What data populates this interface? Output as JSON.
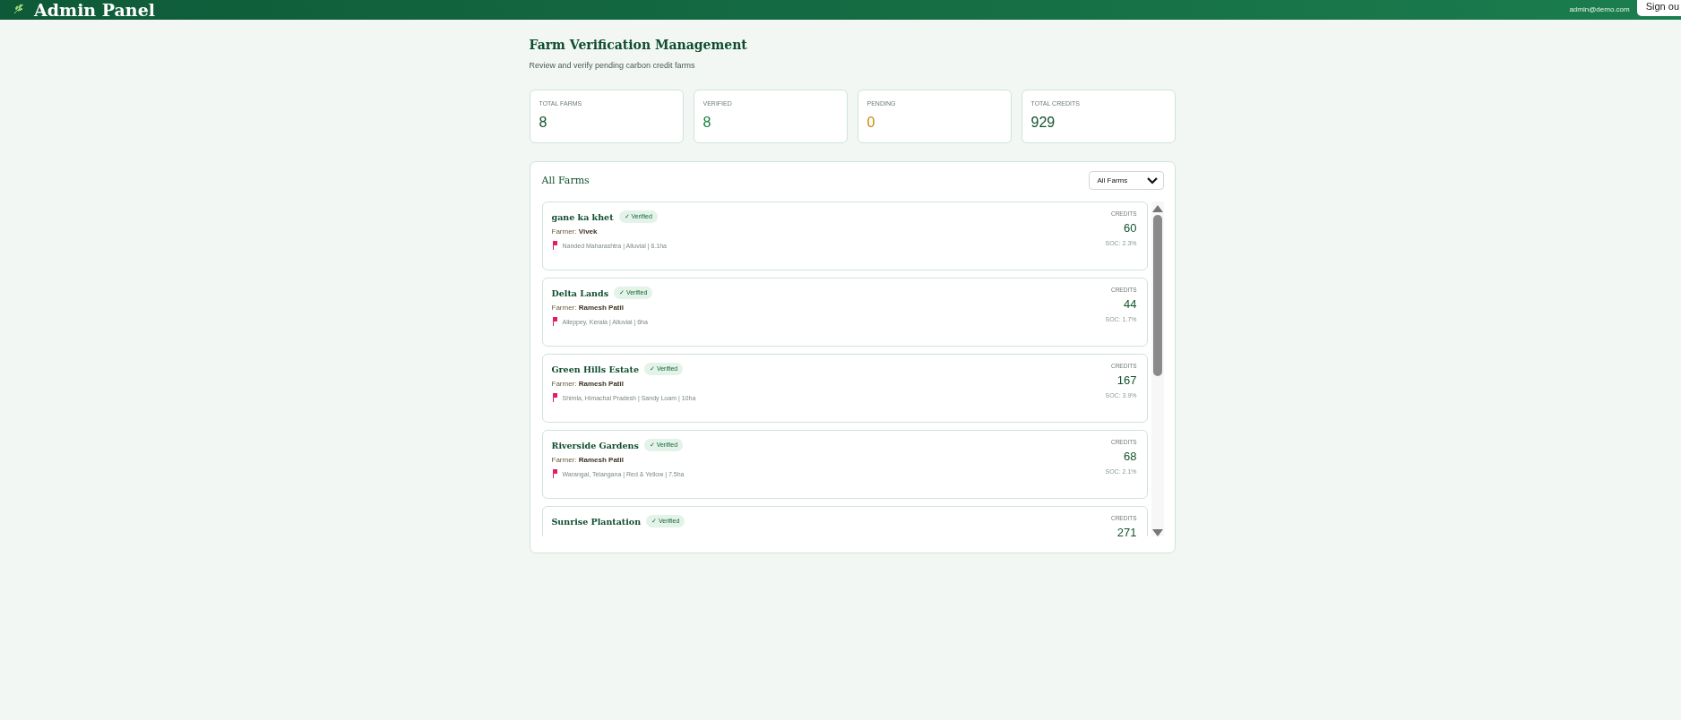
{
  "header": {
    "title": "Admin Panel",
    "email": "admin@demo.com",
    "sign_out": "Sign ou"
  },
  "page": {
    "title": "Farm Verification Management",
    "subtitle": "Review and verify pending carbon credit farms"
  },
  "stats": [
    {
      "label": "TOTAL FARMS",
      "value": "8",
      "color": "#14532d"
    },
    {
      "label": "VERIFIED",
      "value": "8",
      "color": "#15803d"
    },
    {
      "label": "PENDING",
      "value": "0",
      "color": "#ca8a04"
    },
    {
      "label": "TOTAL CREDITS",
      "value": "929",
      "color": "#14532d"
    }
  ],
  "farms_panel": {
    "title": "All Farms",
    "filter": "All Farms",
    "farms": [
      {
        "name": "gane ka khet",
        "badge": "✓ Verified",
        "verified": true,
        "farmer_label": "Farmer:",
        "farmer": "Vivek",
        "location": "Nanded Maharashtra | Alluvial | 6.1ha",
        "credits_label": "CREDITS",
        "credits": "60",
        "soc": "SOC: 2.3%"
      },
      {
        "name": "Delta Lands",
        "badge": "✓ Verified",
        "verified": true,
        "farmer_label": "Farmer:",
        "farmer": "Ramesh Patil",
        "location": "Alleppey, Kerala | Alluvial | 6ha",
        "credits_label": "CREDITS",
        "credits": "44",
        "soc": "SOC: 1.7%"
      },
      {
        "name": "Green Hills Estate",
        "badge": "✓ Verified",
        "verified": true,
        "farmer_label": "Farmer:",
        "farmer": "Ramesh Patil",
        "location": "Shimla, Himachal Pradesh | Sandy Loam | 10ha",
        "credits_label": "CREDITS",
        "credits": "167",
        "soc": "SOC: 3.9%"
      },
      {
        "name": "Riverside Gardens",
        "badge": "✓ Verified",
        "verified": true,
        "farmer_label": "Farmer:",
        "farmer": "Ramesh Patil",
        "location": "Warangal, Telangana | Red & Yellow | 7.5ha",
        "credits_label": "CREDITS",
        "credits": "68",
        "soc": "SOC: 2.1%"
      },
      {
        "name": "Sunrise Plantation",
        "badge": "✓ Verified",
        "verified": true,
        "credits_label": "CREDITS",
        "credits": "271"
      }
    ]
  }
}
